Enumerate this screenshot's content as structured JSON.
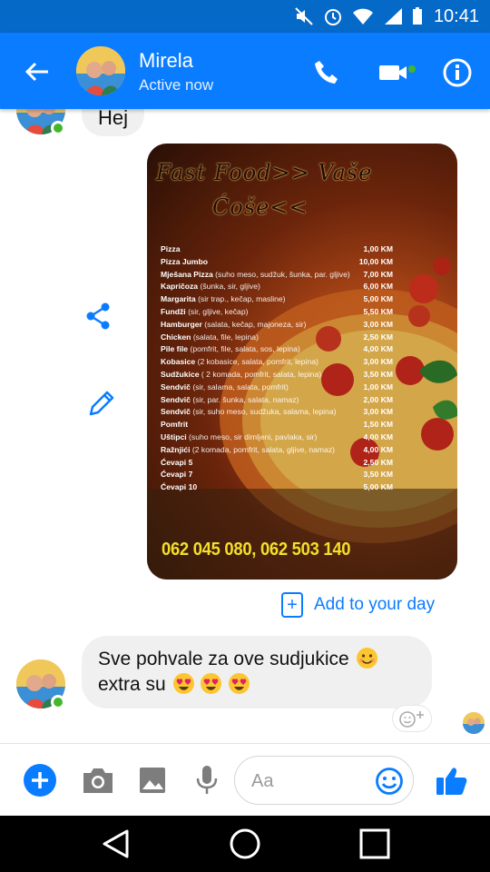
{
  "status_bar": {
    "time": "10:41"
  },
  "header": {
    "contact_name": "Mirela",
    "contact_status": "Active now",
    "accent_color": "#0a7cff"
  },
  "messages": {
    "hej_text": "Hej",
    "menu_image": {
      "title_line1": "Fast Food>> Vaše",
      "title_line2": "Ćoše<<",
      "items": [
        {
          "name": "Pizza",
          "desc": "",
          "price": "1,00 KM"
        },
        {
          "name": "Pizza Jumbo",
          "desc": "",
          "price": "10,00 KM"
        },
        {
          "name": "Mješana Pizza",
          "desc": "(suho meso, sudžuk, šunka, par. gljive)",
          "price": "7,00 KM"
        },
        {
          "name": "Kapričoza",
          "desc": "(šunka, sir, gljive)",
          "price": "6,00 KM"
        },
        {
          "name": "Margarita",
          "desc": "(sir trap., kečap, masline)",
          "price": "5,00 KM"
        },
        {
          "name": "Fundži",
          "desc": "(sir, gljive, kečap)",
          "price": "5,50 KM"
        },
        {
          "name": "Hamburger",
          "desc": "(salata, kečap, majoneza, sir)",
          "price": "3,00 KM"
        },
        {
          "name": "Chicken",
          "desc": "(salata, file, lepina)",
          "price": "2,50 KM"
        },
        {
          "name": "Pile file",
          "desc": "(pomfrit, file, salata, sos, lepina)",
          "price": "4,00 KM"
        },
        {
          "name": "Kobasice",
          "desc": "(2 kobasice, salata, pomfrit, lepina)",
          "price": "3,00 KM"
        },
        {
          "name": "Sudžukice",
          "desc": "( 2 komada, pomfrit, salata, lepina)",
          "price": "3,50 KM"
        },
        {
          "name": "Sendvič",
          "desc": "(sir, salama, salata, pomfrit)",
          "price": "1,00 KM"
        },
        {
          "name": "Sendvič",
          "desc": "(sir, par. šunka, salata, namaz)",
          "price": "2,00 KM"
        },
        {
          "name": "Sendvič",
          "desc": "(sir, suho meso, sudžuka, salama, lepina)",
          "price": "3,00 KM"
        },
        {
          "name": "Pomfrit",
          "desc": "",
          "price": "1,50 KM"
        },
        {
          "name": "Uštipci",
          "desc": "(suho meso, sir dimljeni, pavlaka, sir)",
          "price": "4,00 KM"
        },
        {
          "name": "Ražnjići",
          "desc": "(2 komada, pomfrit, salata, gljive, namaz)",
          "price": "4,00 KM"
        },
        {
          "name": "Ćevapi 5",
          "desc": "",
          "price": "2,50 KM"
        },
        {
          "name": "Ćevapi 7",
          "desc": "",
          "price": "3,50 KM"
        },
        {
          "name": "Ćevapi 10",
          "desc": "",
          "price": "5,00 KM"
        }
      ],
      "phone": "062 045 080, 062 503 140"
    },
    "add_to_day_label": "Add to your day",
    "last_message_line1": "Sve pohvale za ove sudjukice",
    "last_message_line2": "extra su"
  },
  "composer": {
    "placeholder": "Aa"
  },
  "icons": {
    "back": "back-arrow-icon",
    "call": "phone-icon",
    "video": "video-camera-icon",
    "info": "info-icon",
    "share": "share-icon",
    "edit": "pencil-icon",
    "plus": "plus-icon",
    "camera": "camera-icon",
    "gallery": "image-icon",
    "mic": "microphone-icon",
    "emoji": "smiley-icon",
    "like": "thumbs-up-icon"
  }
}
